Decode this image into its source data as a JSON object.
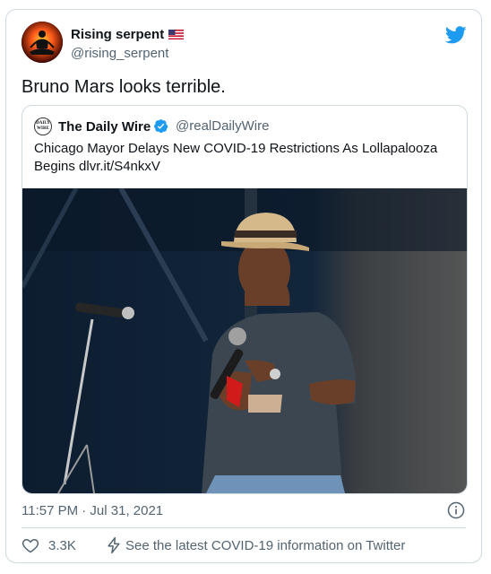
{
  "tweet": {
    "display_name": "Rising serpent",
    "handle": "@rising_serpent",
    "text": "Bruno Mars looks terrible.",
    "timestamp": "11:57 PM · Jul 31, 2021",
    "likes": "3.3K",
    "covid_link": "See the latest COVID-19 information on Twitter"
  },
  "quote": {
    "avatar_text_line1": "DAILY",
    "avatar_text_line2": "WIRE",
    "name": "The Daily Wire",
    "handle": "@realDailyWire",
    "text": "Chicago Mayor Delays New COVID-19 Restrictions As Lollapalooza Begins dlvr.it/S4nkxV"
  },
  "colors": {
    "twitter_blue": "#1d9bf0",
    "secondary_text": "#536471",
    "border": "#cfd9de"
  }
}
